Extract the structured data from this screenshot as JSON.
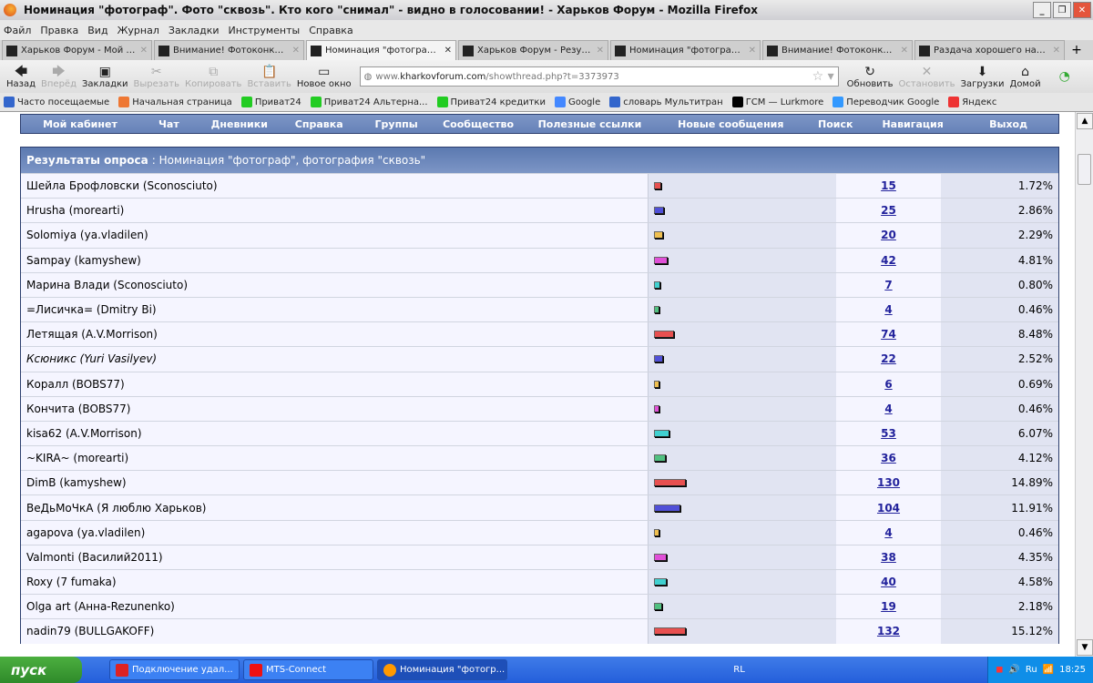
{
  "window": {
    "title": "Номинация \"фотограф\". Фото \"сквозь\". Кто кого \"снимал\" - видно в голосовании! - Харьков Форум - Mozilla Firefox"
  },
  "menu": [
    "Файл",
    "Правка",
    "Вид",
    "Журнал",
    "Закладки",
    "Инструменты",
    "Справка"
  ],
  "tabs": [
    {
      "label": "Харьков Форум - Мой ка..."
    },
    {
      "label": "Внимание! Фотоконкурс:..."
    },
    {
      "label": "Номинация \"фотограф\". ...",
      "active": true
    },
    {
      "label": "Харьков Форум - Резуль..."
    },
    {
      "label": "Номинация \"фотограф\". ..."
    },
    {
      "label": "Внимание! Фотоконкурс:..."
    },
    {
      "label": "Раздача хорошего настр..."
    }
  ],
  "toolbar": {
    "back": "Назад",
    "forward": "Вперёд",
    "bookmarks": "Закладки",
    "cut": "Вырезать",
    "copy": "Копировать",
    "paste": "Вставить",
    "new_window": "Новое окно",
    "reload": "Обновить",
    "stop": "Остановить",
    "downloads": "Загрузки",
    "home": "Домой"
  },
  "url": {
    "prefix": "www.",
    "domain": "kharkovforum.com",
    "path": "/showthread.php?t=3373973"
  },
  "bookmarks": [
    "Часто посещаемые",
    "Начальная страница",
    "Приват24",
    "Приват24 Альтерна...",
    "Приват24 кредитки",
    "Google",
    "словарь Мультитран",
    "ГСМ — Lurkmore",
    "Переводчик Google",
    "Яндекс"
  ],
  "forum_nav": [
    "Мой кабинет",
    "Чат",
    "Дневники",
    "Справка",
    "Группы",
    "Сообщество",
    "Полезные ссылки",
    "Новые сообщения",
    "Поиск",
    "Навигация",
    "Выход"
  ],
  "poll": {
    "label": "Результаты опроса",
    "title": "Номинация \"фотограф\", фотография \"сквозь\"",
    "bar_colors": [
      "#e85050",
      "#5050d8",
      "#f0c050",
      "#e050d8",
      "#40d0d0",
      "#50c080"
    ],
    "options": [
      {
        "name": "Шейла Брофловски (Sconosciuto)",
        "votes": "15",
        "percent": "1.72%",
        "pct": 1.72
      },
      {
        "name": "Hrusha (morearti)",
        "votes": "25",
        "percent": "2.86%",
        "pct": 2.86
      },
      {
        "name": "Solomiya (ya.vladilen)",
        "votes": "20",
        "percent": "2.29%",
        "pct": 2.29
      },
      {
        "name": "Sampay (kamyshew)",
        "votes": "42",
        "percent": "4.81%",
        "pct": 4.81
      },
      {
        "name": "Марина Влади (Sconosciuto)",
        "votes": "7",
        "percent": "0.80%",
        "pct": 0.8
      },
      {
        "name": "=Лисичка= (Dmitry Bi)",
        "votes": "4",
        "percent": "0.46%",
        "pct": 0.46
      },
      {
        "name": "Летящая (A.V.Morrison)",
        "votes": "74",
        "percent": "8.48%",
        "pct": 8.48
      },
      {
        "name": "Ксюникс (Yuri Vasilyev)",
        "votes": "22",
        "percent": "2.52%",
        "pct": 2.52,
        "italic": true
      },
      {
        "name": "Коралл (BOBS77)",
        "votes": "6",
        "percent": "0.69%",
        "pct": 0.69
      },
      {
        "name": "Кончита (BOBS77)",
        "votes": "4",
        "percent": "0.46%",
        "pct": 0.46
      },
      {
        "name": "kisa62 (A.V.Morrison)",
        "votes": "53",
        "percent": "6.07%",
        "pct": 6.07
      },
      {
        "name": "~KIRA~ (morearti)",
        "votes": "36",
        "percent": "4.12%",
        "pct": 4.12
      },
      {
        "name": "DimB (kamyshew)",
        "votes": "130",
        "percent": "14.89%",
        "pct": 14.89
      },
      {
        "name": "ВеДьМоЧкА (Я люблю Харьков)",
        "votes": "104",
        "percent": "11.91%",
        "pct": 11.91
      },
      {
        "name": "agapova (ya.vladilen)",
        "votes": "4",
        "percent": "0.46%",
        "pct": 0.46
      },
      {
        "name": "Valmonti (Василий2011)",
        "votes": "38",
        "percent": "4.35%",
        "pct": 4.35
      },
      {
        "name": "Roxy (7 fumaka)",
        "votes": "40",
        "percent": "4.58%",
        "pct": 4.58
      },
      {
        "name": "Olga art (Анна-Rezunenko)",
        "votes": "19",
        "percent": "2.18%",
        "pct": 2.18
      },
      {
        "name": "nadin79 (BULLGAKOFF)",
        "votes": "132",
        "percent": "15.12%",
        "pct": 15.12
      }
    ]
  },
  "taskbar": {
    "start": "пуск",
    "items": [
      "Подключение удал...",
      "MTS-Connect",
      "Номинация \"фотогр..."
    ],
    "lang": "RL",
    "tray_lang": "Ru",
    "clock": "18:25"
  }
}
